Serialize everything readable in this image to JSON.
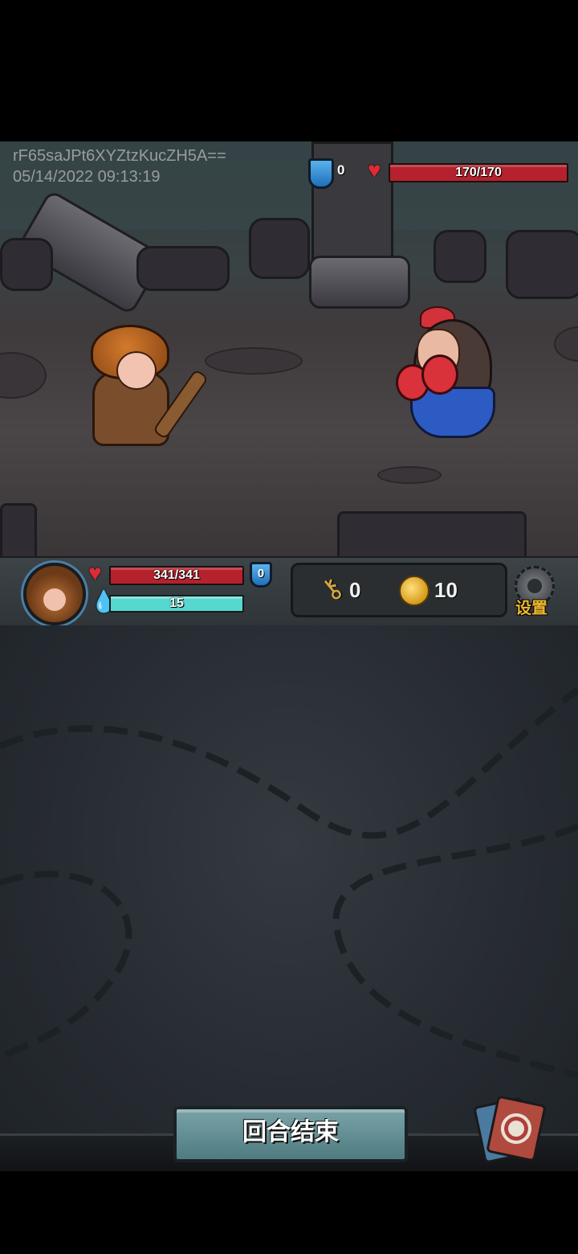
{
  "watermark": {
    "id": "rF65saJPt6XYZtzKucZH5A==",
    "timestamp": "05/14/2022 09:13:19"
  },
  "enemy": {
    "block": "0",
    "hp_text": "170/170",
    "hp_fraction": 1.0,
    "icons": {
      "block": "shield-icon",
      "hp": "heart-icon"
    }
  },
  "player": {
    "hp_text": "341/341",
    "hp_fraction": 1.0,
    "energy_text": "15",
    "energy_fraction": 1.0,
    "block": "0",
    "icons": {
      "hp": "heart-icon",
      "energy": "droplet-icon",
      "block": "shield-icon",
      "portrait": "pumpkin-hero-portrait"
    }
  },
  "resources": {
    "keys": "0",
    "coins": "10",
    "icons": {
      "keys": "key-icon",
      "coins": "coin-icon"
    }
  },
  "settings": {
    "label": "设置",
    "icon": "gear-icon"
  },
  "end_turn": {
    "label": "回合结束"
  },
  "deck": {
    "icon": "draw-pile-icon"
  },
  "colors": {
    "hp_bar": "#b5212c",
    "energy_bar": "#56d7cf",
    "shield": "#3a8fd8",
    "coin": "#e2aa2a",
    "settings_text": "#f0b92d"
  }
}
